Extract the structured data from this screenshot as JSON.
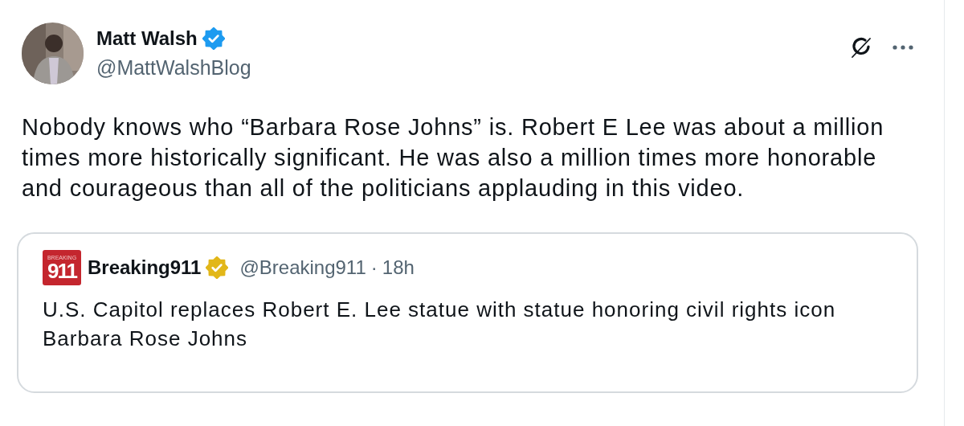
{
  "post": {
    "author": {
      "name": "Matt Walsh",
      "handle": "@MattWalshBlog",
      "verified_badge": {
        "color": "#1d9bf0"
      }
    },
    "text": "Nobody knows who “Barbara Rose Johns” is. Robert E Lee was about a million times more historically significant. He was also a million times more honorable and courageous than all of the politicians applauding in this video.",
    "quote": {
      "logo_top": "BREAKING",
      "logo_main": "911",
      "author": {
        "name": "Breaking911",
        "handle": "@Breaking911",
        "verified_badge": {
          "color": "#e2b719"
        }
      },
      "separator": "·",
      "time": "18h",
      "text": "U.S. Capitol replaces Robert E. Lee statue with statue honoring civil rights icon Barbara Rose Johns"
    }
  }
}
